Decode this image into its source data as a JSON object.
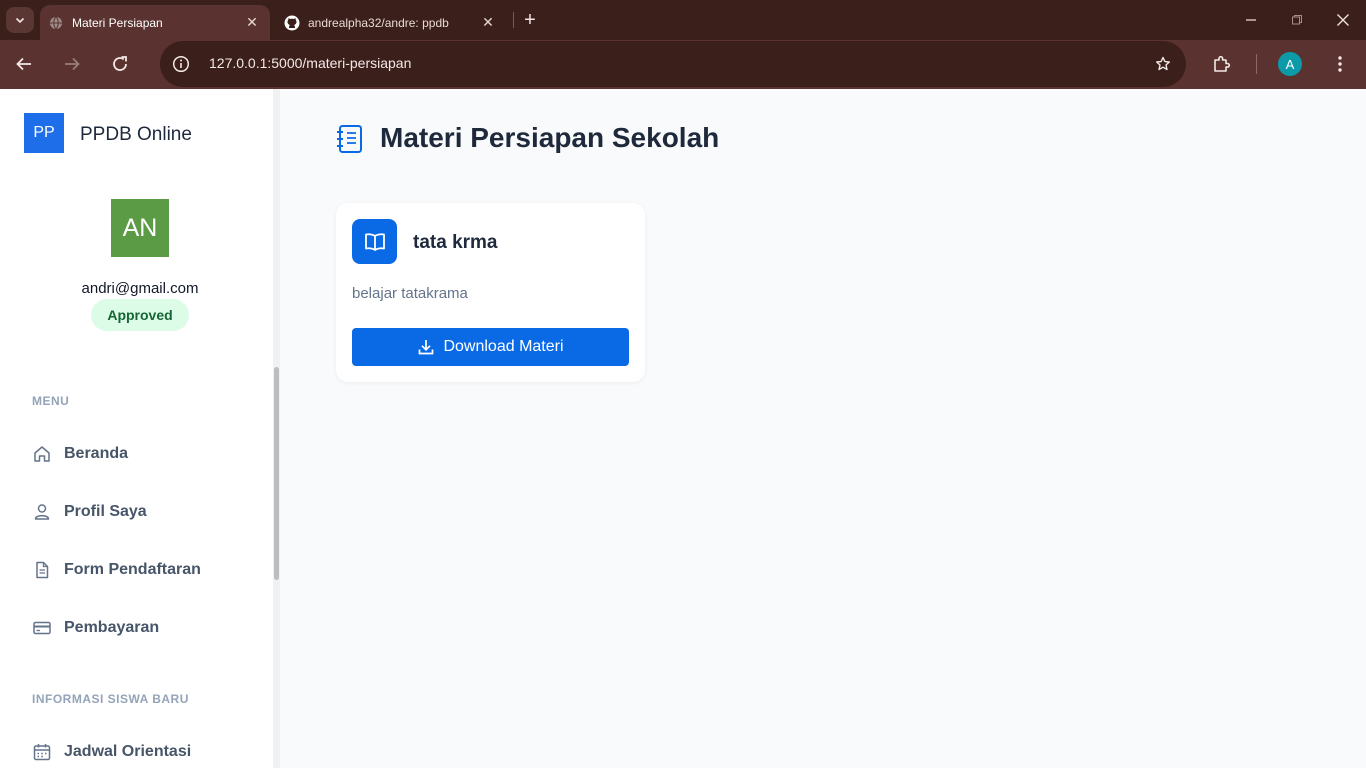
{
  "browser": {
    "tabs": [
      {
        "title": "Materi Persiapan",
        "active": true,
        "favicon": "globe-icon"
      },
      {
        "title": "andrealpha32/andre: ppdb",
        "active": false,
        "favicon": "github-icon"
      }
    ],
    "url": "127.0.0.1:5000/materi-persiapan",
    "profile_initial": "A"
  },
  "sidebar": {
    "brand_logo": "PP",
    "brand_name": "PPDB Online",
    "user": {
      "initials": "AN",
      "email": "andri@gmail.com",
      "status": "Approved"
    },
    "menu_label": "MENU",
    "menu_items": [
      {
        "label": "Beranda",
        "icon": "home-icon"
      },
      {
        "label": "Profil Saya",
        "icon": "user-icon"
      },
      {
        "label": "Form Pendaftaran",
        "icon": "document-icon"
      },
      {
        "label": "Pembayaran",
        "icon": "credit-card-icon"
      }
    ],
    "info_label": "INFORMASI SISWA BARU",
    "info_items": [
      {
        "label": "Jadwal Orientasi",
        "icon": "calendar-icon"
      }
    ]
  },
  "main": {
    "title": "Materi Persiapan Sekolah",
    "title_icon": "notebook-icon",
    "cards": [
      {
        "title": "tata krma",
        "description": "belajar tatakrama",
        "button": "Download Materi",
        "icon": "book-icon"
      }
    ]
  },
  "colors": {
    "primary": "#0a6ae6",
    "avatar": "#5b9b45",
    "badge_bg": "#dcfce7",
    "badge_text": "#166534",
    "chrome_dark": "#3b1f1b",
    "chrome": "#5a3230"
  }
}
